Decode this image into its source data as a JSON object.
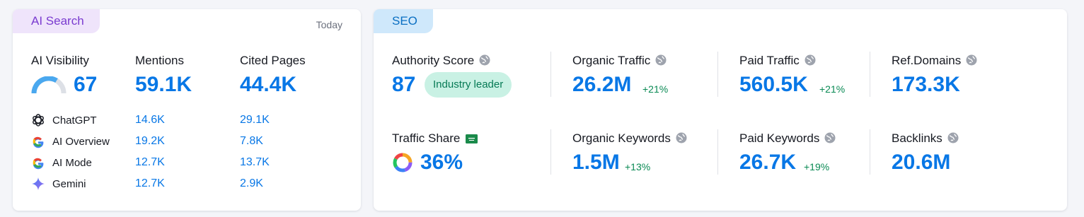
{
  "ai_search": {
    "tag": "AI Search",
    "period": "Today",
    "visibility_label": "AI Visibility",
    "visibility_value": "67",
    "mentions_label": "Mentions",
    "mentions_value": "59.1K",
    "cited_label": "Cited Pages",
    "cited_value": "44.4K",
    "rows": [
      {
        "name": "ChatGPT",
        "mentions": "14.6K",
        "cited": "29.1K",
        "icon": "chatgpt-icon"
      },
      {
        "name": "AI Overview",
        "mentions": "19.2K",
        "cited": "7.8K",
        "icon": "google-icon"
      },
      {
        "name": "AI Mode",
        "mentions": "12.7K",
        "cited": "13.7K",
        "icon": "google-icon"
      },
      {
        "name": "Gemini",
        "mentions": "12.7K",
        "cited": "2.9K",
        "icon": "gemini-icon"
      }
    ],
    "visibility_gauge_fraction": 0.67
  },
  "seo": {
    "tag": "SEO",
    "authority_label": "Authority Score",
    "authority_value": "87",
    "authority_badge": "Industry leader",
    "traffic_share_label": "Traffic Share",
    "traffic_share_value": "36%",
    "organic_traffic_label": "Organic Traffic",
    "organic_traffic_value": "26.2M",
    "organic_traffic_delta": "+21%",
    "organic_keywords_label": "Organic Keywords",
    "organic_keywords_value": "1.5M",
    "organic_keywords_delta": "+13%",
    "paid_traffic_label": "Paid Traffic",
    "paid_traffic_value": "560.5K",
    "paid_traffic_delta": "+21%",
    "paid_keywords_label": "Paid Keywords",
    "paid_keywords_value": "26.7K",
    "paid_keywords_delta": "+19%",
    "ref_domains_label": "Ref.Domains",
    "ref_domains_value": "173.3K",
    "backlinks_label": "Backlinks",
    "backlinks_value": "20.6M"
  },
  "colors": {
    "accent_blue": "#0877e6",
    "positive_green": "#0a8a54",
    "ai_tag_bg": "#efe4fb",
    "seo_tag_bg": "#cfe8fb",
    "badge_bg": "#c9f1e4"
  }
}
